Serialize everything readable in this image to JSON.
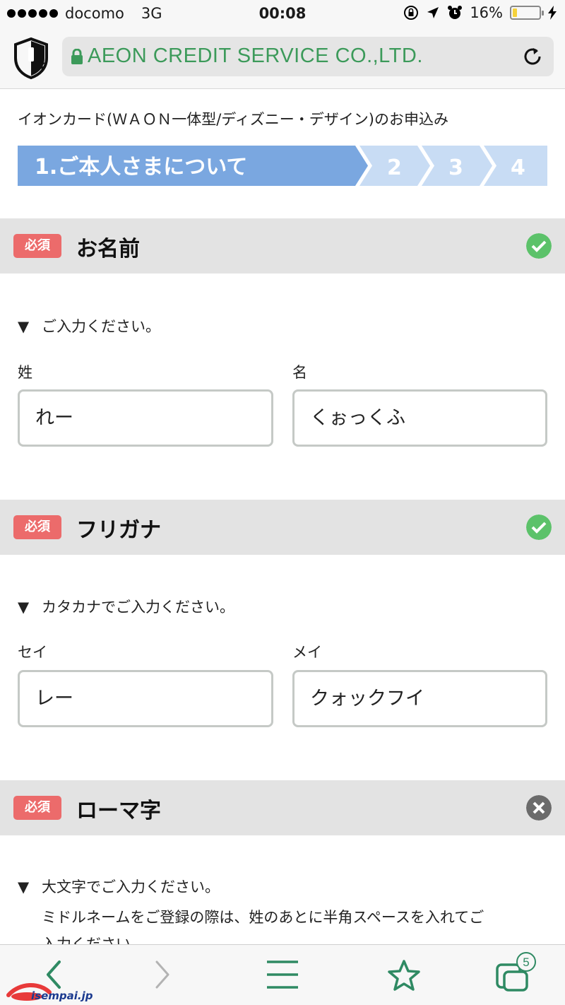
{
  "status_bar": {
    "carrier": "docomo",
    "network": "3G",
    "time": "00:08",
    "battery_percent": "16%",
    "battery_level": 0.16,
    "icons": [
      "rotation-lock-icon",
      "location-arrow-icon",
      "alarm-icon",
      "charging-bolt-icon"
    ]
  },
  "browser": {
    "url_text": "AEON CREDIT SERVICE CO.,LTD.",
    "url_color": "#3c9a5a",
    "tab_count": "5"
  },
  "page": {
    "title": "イオンカード(ＷＡＯＮ一体型/ディズニー・デザイン)のお申込み",
    "steps": [
      "1.ご本人さまについて",
      "2",
      "3",
      "4"
    ],
    "active_step": 1,
    "step_active_color": "#7aa7e0",
    "step_inactive_color": "#c8dcf4"
  },
  "sections": [
    {
      "badge": "必須",
      "title": "お名前",
      "status": "valid",
      "instruction": "ご入力ください。",
      "fields": [
        {
          "label": "姓",
          "value": "れー"
        },
        {
          "label": "名",
          "value": "くぉっくふ"
        }
      ]
    },
    {
      "badge": "必須",
      "title": "フリガナ",
      "status": "valid",
      "instruction": "カタカナでご入力ください。",
      "fields": [
        {
          "label": "セイ",
          "value": "レー"
        },
        {
          "label": "メイ",
          "value": "クォックフイ"
        }
      ]
    },
    {
      "badge": "必須",
      "title": "ローマ字",
      "status": "invalid",
      "instruction": "大文字でご入力ください。",
      "instruction_line2": "ミドルネームをご登録の際は、姓のあとに半角スペースを入れてご",
      "instruction_line3": "入力ください。"
    }
  ],
  "colors": {
    "required_badge": "#ec6b6b",
    "valid": "#5cc26a",
    "invalid": "#6b6b6b",
    "toolbar_icon": "#2f8a63"
  },
  "watermark": "isempai.jp"
}
